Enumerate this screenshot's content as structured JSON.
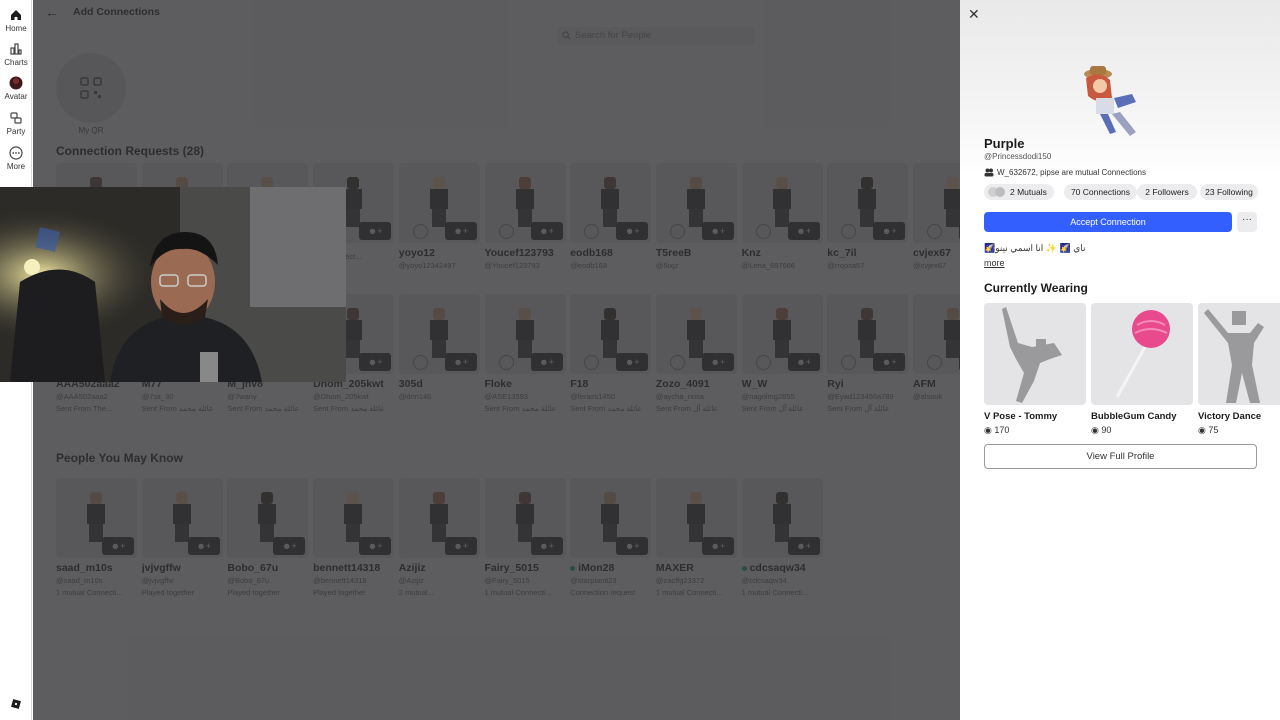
{
  "nav": {
    "items": [
      {
        "label": "Home",
        "icon": "home-icon"
      },
      {
        "label": "Charts",
        "icon": "charts-icon"
      },
      {
        "label": "Avatar",
        "icon": "avatar-icon"
      },
      {
        "label": "Party",
        "icon": "party-icon"
      },
      {
        "label": "More",
        "icon": "more-icon"
      }
    ]
  },
  "header": {
    "title": "Add Connections",
    "back_icon": "back-arrow-icon"
  },
  "search": {
    "placeholder": "Search for People"
  },
  "qr": {
    "label": "My QR"
  },
  "requests": {
    "title": "Connection Requests (28)",
    "row1": [
      {
        "name": "",
        "user": "",
        "meta": ""
      },
      {
        "name": "",
        "user": "",
        "meta": ""
      },
      {
        "name": "",
        "user": "",
        "meta": ""
      },
      {
        "name": "",
        "user": "",
        "meta": "...al Connect..."
      },
      {
        "name": "yoyo12",
        "user": "@yoyo12342497",
        "meta": ""
      },
      {
        "name": "Youcef123793",
        "user": "@Youcef123793",
        "meta": ""
      },
      {
        "name": "eodb168",
        "user": "@eodb168",
        "meta": ""
      },
      {
        "name": "T5reeB",
        "user": "@5ixjz",
        "meta": ""
      },
      {
        "name": "Knz",
        "user": "@Lena_697666",
        "meta": ""
      },
      {
        "name": "kc_7il",
        "user": "@rrqosa57",
        "meta": ""
      },
      {
        "name": "cvjex67",
        "user": "@cvjex67",
        "meta": ""
      }
    ],
    "row2": [
      {
        "name": "AAA502aaa2",
        "user": "@AAA502aaa2",
        "meta": "Sent From The..."
      },
      {
        "name": "M77",
        "user": "@7sit_30",
        "meta": "Sent From عائلة محمد"
      },
      {
        "name": "M_jhv8",
        "user": "@7wany",
        "meta": "Sent From عائلة محمد"
      },
      {
        "name": "Dhom_205kwt",
        "user": "@Dhom_205kwt",
        "meta": "Sent From عائلة محمد"
      },
      {
        "name": "305d",
        "user": "@dnn140",
        "meta": ""
      },
      {
        "name": "Floke",
        "user": "@ASE13593",
        "meta": "Sent From عائلة محمد"
      },
      {
        "name": "F18",
        "user": "@ferass1450",
        "meta": "Sent From عائلة محمد"
      },
      {
        "name": "Zozo_4091",
        "user": "@aycha_nosa",
        "meta": "Sent From عائلة آل"
      },
      {
        "name": "W_W",
        "user": "@nagolmg2855",
        "meta": "Sent From عائلة آل"
      },
      {
        "name": "Ryi",
        "user": "@Eyad123456a789",
        "meta": "Sent From عائلة آل"
      },
      {
        "name": "AFM",
        "user": "@alsouk",
        "meta": ""
      }
    ]
  },
  "suggestions": {
    "title": "People You May Know",
    "items": [
      {
        "name": "saad_m10s",
        "user": "@saad_m10s",
        "meta": "1 mutual Connecti...",
        "online": false
      },
      {
        "name": "jvjvgffw",
        "user": "@jvjvgffw",
        "meta": "Played together",
        "online": false
      },
      {
        "name": "Bobo_67u",
        "user": "@Bobo_67u",
        "meta": "Played together",
        "online": false
      },
      {
        "name": "bennett14318",
        "user": "@bennett14318",
        "meta": "Played together",
        "online": false
      },
      {
        "name": "Azijiz",
        "user": "@Azijiz",
        "meta": "2 mutual...",
        "online": false
      },
      {
        "name": "Fairy_5015",
        "user": "@Fairy_5015",
        "meta": "1 mutual Connecti...",
        "online": false
      },
      {
        "name": "iMon28",
        "user": "@starplanti23",
        "meta": "Connection request",
        "online": true
      },
      {
        "name": "MAXER",
        "user": "@zacffg23372",
        "meta": "1 mutual Connecti...",
        "online": false
      },
      {
        "name": "cdcsaqw34",
        "user": "@cdcsaqw34",
        "meta": "1 mutual Connecti...",
        "online": true
      }
    ]
  },
  "profile": {
    "name": "Purple",
    "username": "@Princessdodi150",
    "mutual_text": "W_632672, pipse are mutual Connections",
    "stats": {
      "mutuals": "2 Mutuals",
      "connections": "70 Connections",
      "followers": "2 Followers",
      "following": "23 Following"
    },
    "accept_label": "Accept Connection",
    "more_label": "···",
    "bio": "🌠ناي 🌠 ✨ انا اسمي نينو",
    "bio_more": "more",
    "wearing_title": "Currently Wearing",
    "wearing": [
      {
        "name": "V Pose - Tommy",
        "price": "170"
      },
      {
        "name": "BubbleGum Candy",
        "price": "90"
      },
      {
        "name": "Victory Dance",
        "price": "75"
      }
    ],
    "view_full_label": "View Full Profile"
  },
  "colors": {
    "accent": "#335fff",
    "dim_overlay": "#323234",
    "online": "#00b06f"
  }
}
